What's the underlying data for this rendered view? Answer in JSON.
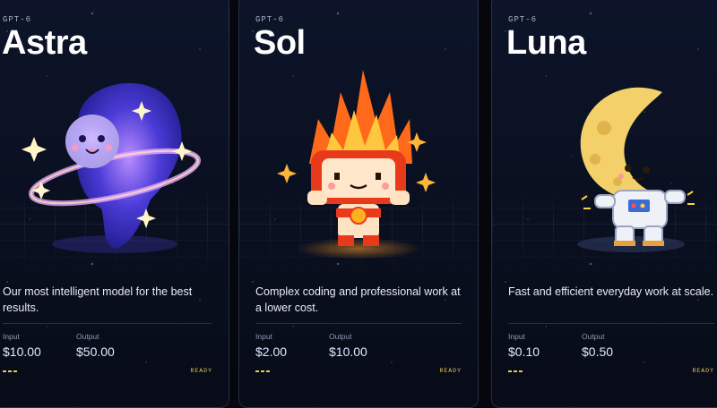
{
  "cards": [
    {
      "family": "GPT-6",
      "name": "Astra",
      "description": "Our most intelligent model for the best results.",
      "input_label": "Input",
      "input_price": "$10.00",
      "output_label": "Output",
      "output_price": "$50.00",
      "status": "READY",
      "mascot_icon": "galaxy-mascot-icon"
    },
    {
      "family": "GPT-6",
      "name": "Sol",
      "description": "Complex coding and professional work at a lower cost.",
      "input_label": "Input",
      "input_price": "$2.00",
      "output_label": "Output",
      "output_price": "$10.00",
      "status": "READY",
      "mascot_icon": "sun-mascot-icon"
    },
    {
      "family": "GPT-6",
      "name": "Luna",
      "description": "Fast and efficient everyday work at scale.",
      "input_label": "Input",
      "input_price": "$0.10",
      "output_label": "Output",
      "output_price": "$0.50",
      "status": "READY",
      "mascot_icon": "moon-mascot-icon"
    }
  ],
  "colors": {
    "background": "#05070d",
    "card": "#0e162c",
    "accent": "#e8c85a",
    "price": "#dfe8ff"
  }
}
